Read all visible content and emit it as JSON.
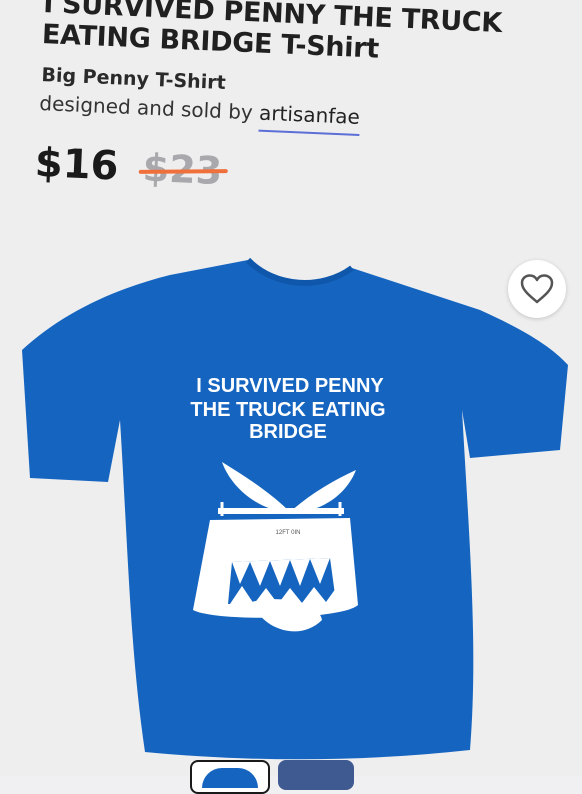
{
  "product": {
    "title_line1": "I SURVIVED PENNY THE TRUCK",
    "title_line2": "EATING BRIDGE T-Shirt",
    "subtitle": "Big Penny T-Shirt",
    "byline_prefix": "designed and sold by",
    "seller": "artisanfae",
    "price": "$16",
    "old_price": "$23"
  },
  "artwork": {
    "line1": "I SURVIVED PENNY",
    "line2": "THE TRUCK EATING",
    "line3": "BRIDGE",
    "bridge_sign": "12FT 0IN"
  },
  "colors": {
    "shirt": "#1565c0",
    "strike": "#f0703c",
    "seller_underline": "#5b6fd6"
  },
  "icons": {
    "favorite": "heart-icon"
  }
}
